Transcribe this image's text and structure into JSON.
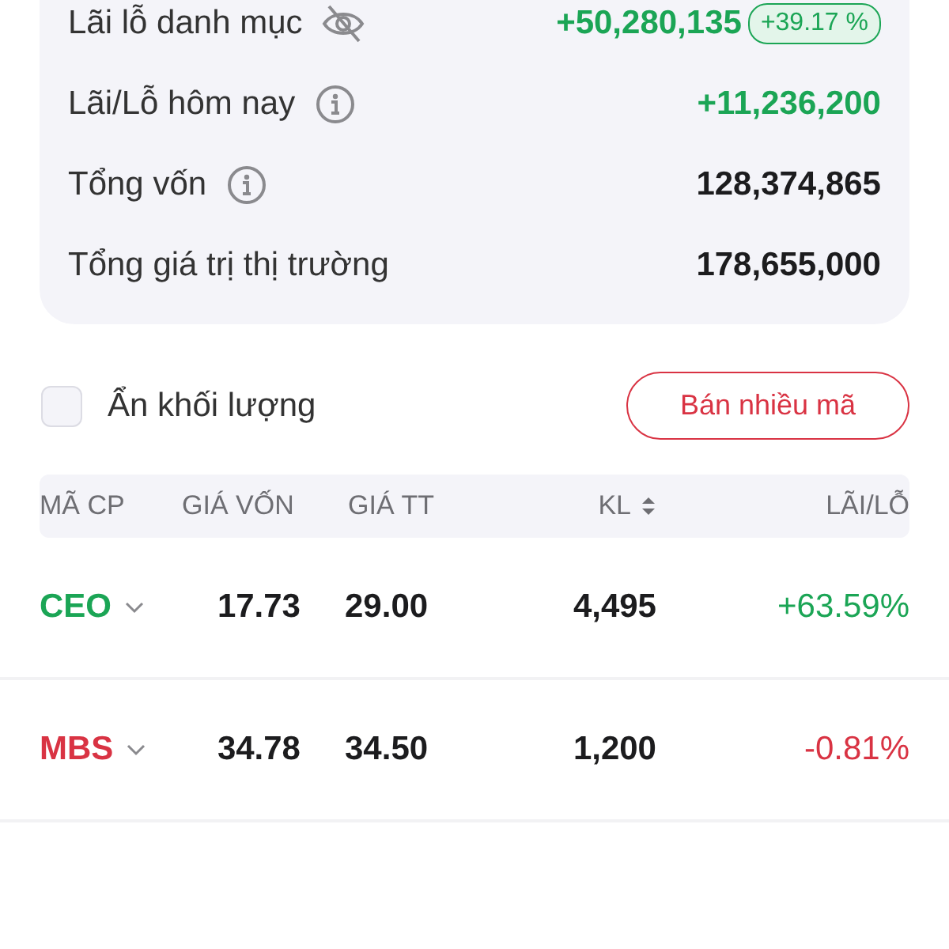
{
  "summary": [
    {
      "label": "Lãi lỗ danh mục",
      "kind": "toggle",
      "value": "+50,280,135",
      "color": "#1ba555",
      "badge": "+39.17 %"
    },
    {
      "label": "Lãi/Lỗ hôm nay",
      "kind": "info",
      "value": "+11,236,200",
      "color": "#1ba555"
    },
    {
      "label": "Tổng vốn",
      "kind": "info",
      "value": "128,374,865",
      "color": "#1c1c1e"
    },
    {
      "label": "Tổng giá trị thị trường",
      "kind": "plain",
      "value": "178,655,000",
      "color": "#1c1c1e"
    }
  ],
  "hide_volume": {
    "label": "Ẩn khối lượng",
    "checked": false
  },
  "sell_button": "Bán nhiều mã",
  "table": {
    "columns": [
      "MÃ CP",
      "GIÁ VỐN",
      "GIÁ TT",
      "KL",
      "LÃI/LỖ"
    ],
    "rows": [
      {
        "symbol": "CEO",
        "color": "#1ba555",
        "cost": "17.73",
        "price": "29.00",
        "volume": "4,495",
        "pnl": "+63.59%"
      },
      {
        "symbol": "MBS",
        "color": "#d93343",
        "cost": "34.78",
        "price": "34.50",
        "volume": "1,200",
        "pnl": "-0.81%"
      }
    ]
  }
}
